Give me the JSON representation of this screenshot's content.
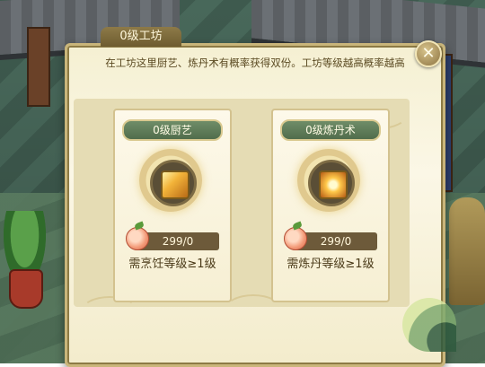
{
  "dialog": {
    "title": "0级工坊",
    "hint": "在工坊这里厨艺、炼丹术有概率获得双份。工坊等级越高概率越高",
    "close_icon": "close-icon"
  },
  "cards": [
    {
      "title": "0级厨艺",
      "icon": "cooking-skill-icon",
      "cost_icon": "peach-icon",
      "cost": "299/0",
      "requirement": "需烹饪等级≥1级"
    },
    {
      "title": "0级炼丹术",
      "icon": "alchemy-skill-icon",
      "cost_icon": "peach-icon",
      "cost": "299/0",
      "requirement": "需炼丹等级≥1级"
    }
  ],
  "colors": {
    "panel_bg": "#f5f0d2",
    "card_title_bg": "#6f8d68",
    "cost_bar_bg": "#6d5a3a",
    "title_tab_bg": "#8d7a48"
  }
}
